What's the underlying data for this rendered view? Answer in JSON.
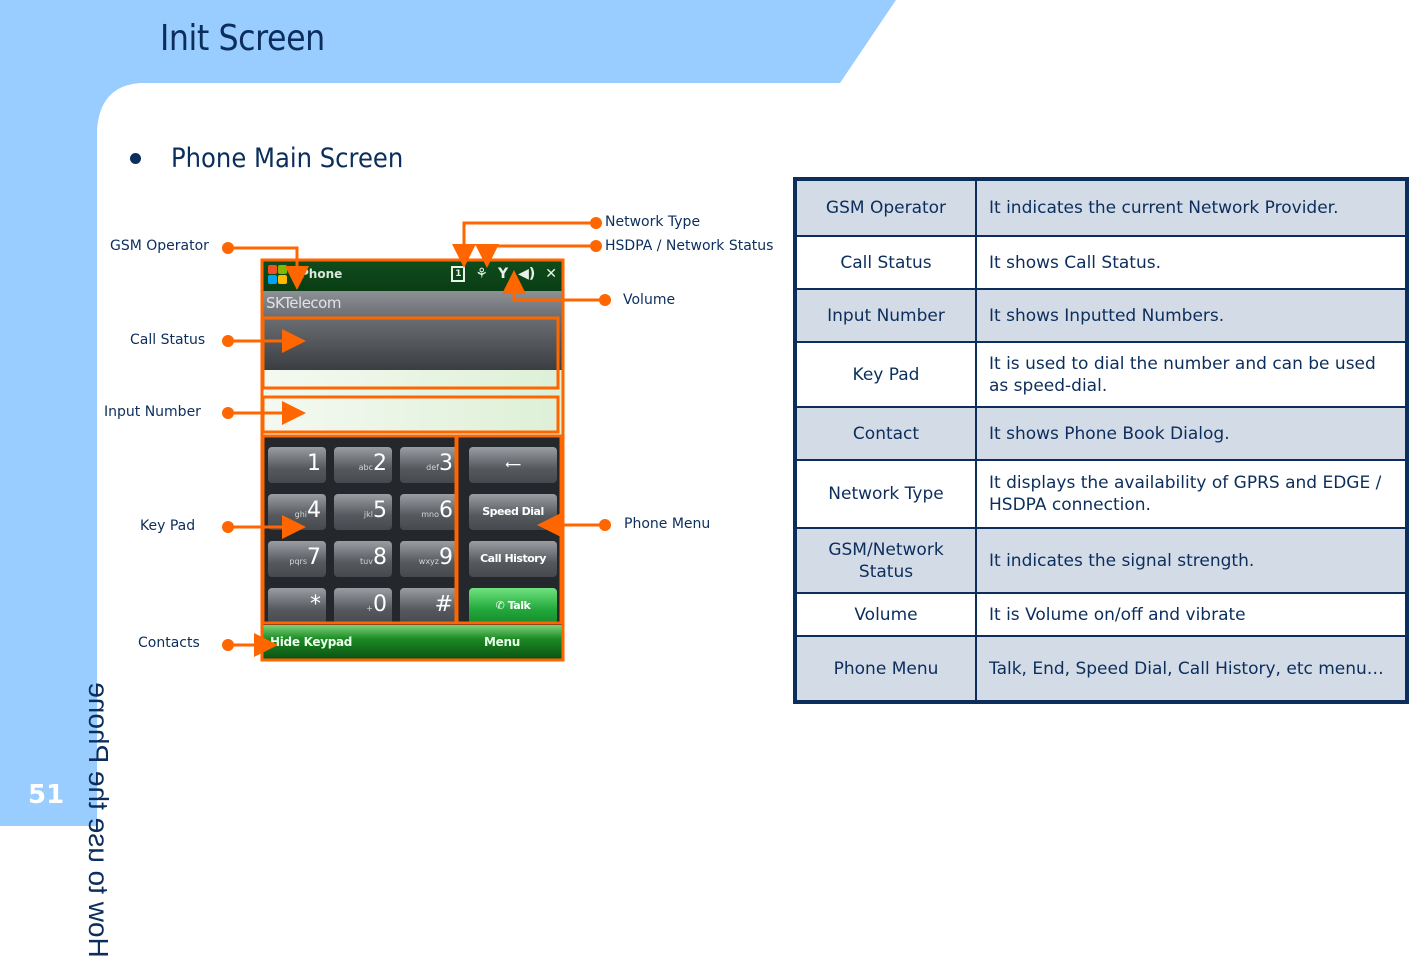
{
  "slide": {
    "title": "Init Screen",
    "side_title": "How to use the Phone",
    "page_number": "51",
    "bullet": "Phone Main Screen",
    "colors": {
      "band": "#99ccff",
      "text": "#0b2e5c",
      "callout": "#ff6600",
      "table_shade": "#d3dbe6"
    }
  },
  "callouts": {
    "gsm_operator": "GSM Operator",
    "call_status": "Call Status",
    "input_number": "Input Number",
    "key_pad": "Key Pad",
    "contacts": "Contacts",
    "network_type": "Network Type",
    "hsdpa_status": "HSDPA / Network Status",
    "volume": "Volume",
    "phone_menu": "Phone Menu"
  },
  "phone": {
    "app_title": "Phone",
    "operator": "SKTelecom",
    "status_icons": [
      "sim-icon",
      "network-type-icon",
      "signal-icon",
      "volume-icon",
      "close-icon"
    ],
    "keys": [
      {
        "sub": "",
        "main": "1"
      },
      {
        "sub": "abc",
        "main": "2"
      },
      {
        "sub": "def",
        "main": "3"
      },
      {
        "sub": "ghi",
        "main": "4"
      },
      {
        "sub": "jkl",
        "main": "5"
      },
      {
        "sub": "mno",
        "main": "6"
      },
      {
        "sub": "pqrs",
        "main": "7"
      },
      {
        "sub": "tuv",
        "main": "8"
      },
      {
        "sub": "wxyz",
        "main": "9"
      },
      {
        "sub": "",
        "main": "*"
      },
      {
        "sub": "+",
        "main": "0"
      },
      {
        "sub": "",
        "main": "#"
      }
    ],
    "function_keys": {
      "backspace": "⟵",
      "speed_dial": "Speed Dial",
      "call_history": "Call History",
      "talk": "Talk"
    },
    "softkeys": {
      "left": "Hide Keypad",
      "right": "Menu"
    }
  },
  "table": {
    "rows": [
      {
        "item": "GSM Operator",
        "desc": "It indicates the current Network Provider.",
        "shade": true
      },
      {
        "item": "Call Status",
        "desc": "It shows Call Status.",
        "shade": false
      },
      {
        "item": "Input Number",
        "desc": "It shows Inputted Numbers.",
        "shade": true
      },
      {
        "item": "Key Pad",
        "desc": "It is used to dial the number and can be used as speed-dial.",
        "shade": false
      },
      {
        "item": "Contact",
        "desc": "It shows Phone Book Dialog.",
        "shade": true
      },
      {
        "item": "Network Type",
        "desc": "It displays the availability of GPRS and EDGE  / HSDPA connection.",
        "shade": false
      },
      {
        "item": "GSM/Network Status",
        "desc": "It indicates the signal strength.",
        "shade": true
      },
      {
        "item": "Volume",
        "desc": "It is Volume on/off and vibrate",
        "shade": false
      },
      {
        "item": "Phone Menu",
        "desc": "Talk, End, Speed Dial, Call History, etc menu…",
        "shade": true
      }
    ]
  }
}
